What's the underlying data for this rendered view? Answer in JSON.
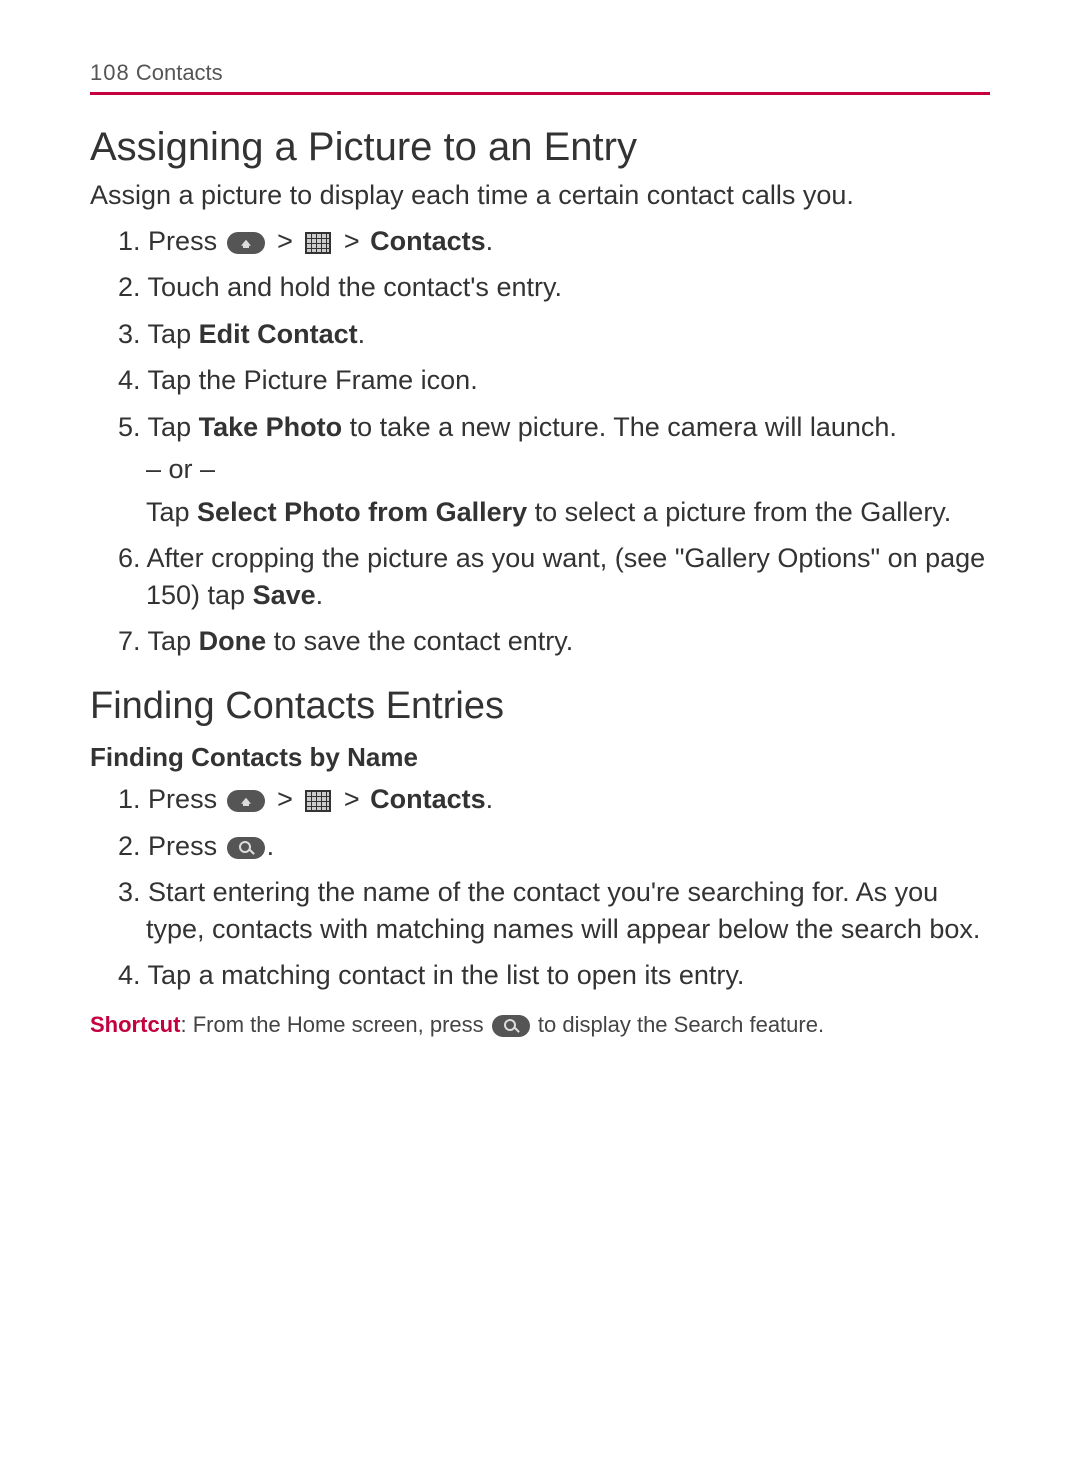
{
  "header": {
    "page_number": "108",
    "section": "Contacts"
  },
  "s1": {
    "heading": "Assigning a Picture to an Entry",
    "intro": "Assign a picture to display each time a certain contact calls you.",
    "steps": {
      "n1": "1.",
      "t1a": "Press ",
      "t1b": " > ",
      "t1c": " > ",
      "t1d": "Contacts",
      "t1e": ".",
      "n2": "2.",
      "t2": "Touch and hold the contact's entry.",
      "n3": "3.",
      "t3a": "Tap ",
      "t3b": "Edit Contact",
      "t3c": ".",
      "n4": "4.",
      "t4": "Tap the Picture Frame icon.",
      "n5": "5.",
      "t5a": "Tap ",
      "t5b": "Take Photo",
      "t5c": " to take a new picture. The camera will launch.",
      "or": "– or –",
      "t5d": "Tap ",
      "t5e": "Select Photo from Gallery",
      "t5f": " to select a picture from the Gallery.",
      "n6": "6.",
      "t6a": "After cropping the picture as you want, (see \"Gallery Options\" on page 150) tap ",
      "t6b": "Save",
      "t6c": ".",
      "n7": "7.",
      "t7a": "Tap ",
      "t7b": "Done",
      "t7c": " to save the contact entry."
    }
  },
  "s2": {
    "heading": "Finding Contacts Entries",
    "subheading": "Finding Contacts by Name",
    "steps": {
      "n1": "1.",
      "t1a": "Press ",
      "t1b": " > ",
      "t1c": " > ",
      "t1d": "Contacts",
      "t1e": ".",
      "n2": "2.",
      "t2a": "Press ",
      "t2b": ".",
      "n3": "3.",
      "t3": "Start entering the name of the contact you're searching for. As you type, contacts with matching names will appear below the search box.",
      "n4": "4.",
      "t4": "Tap a matching contact in the list to open its entry."
    },
    "shortcut": {
      "label": "Shortcut",
      "sep": ": ",
      "a": "From the Home screen, press ",
      "b": " to display the Search feature."
    }
  }
}
